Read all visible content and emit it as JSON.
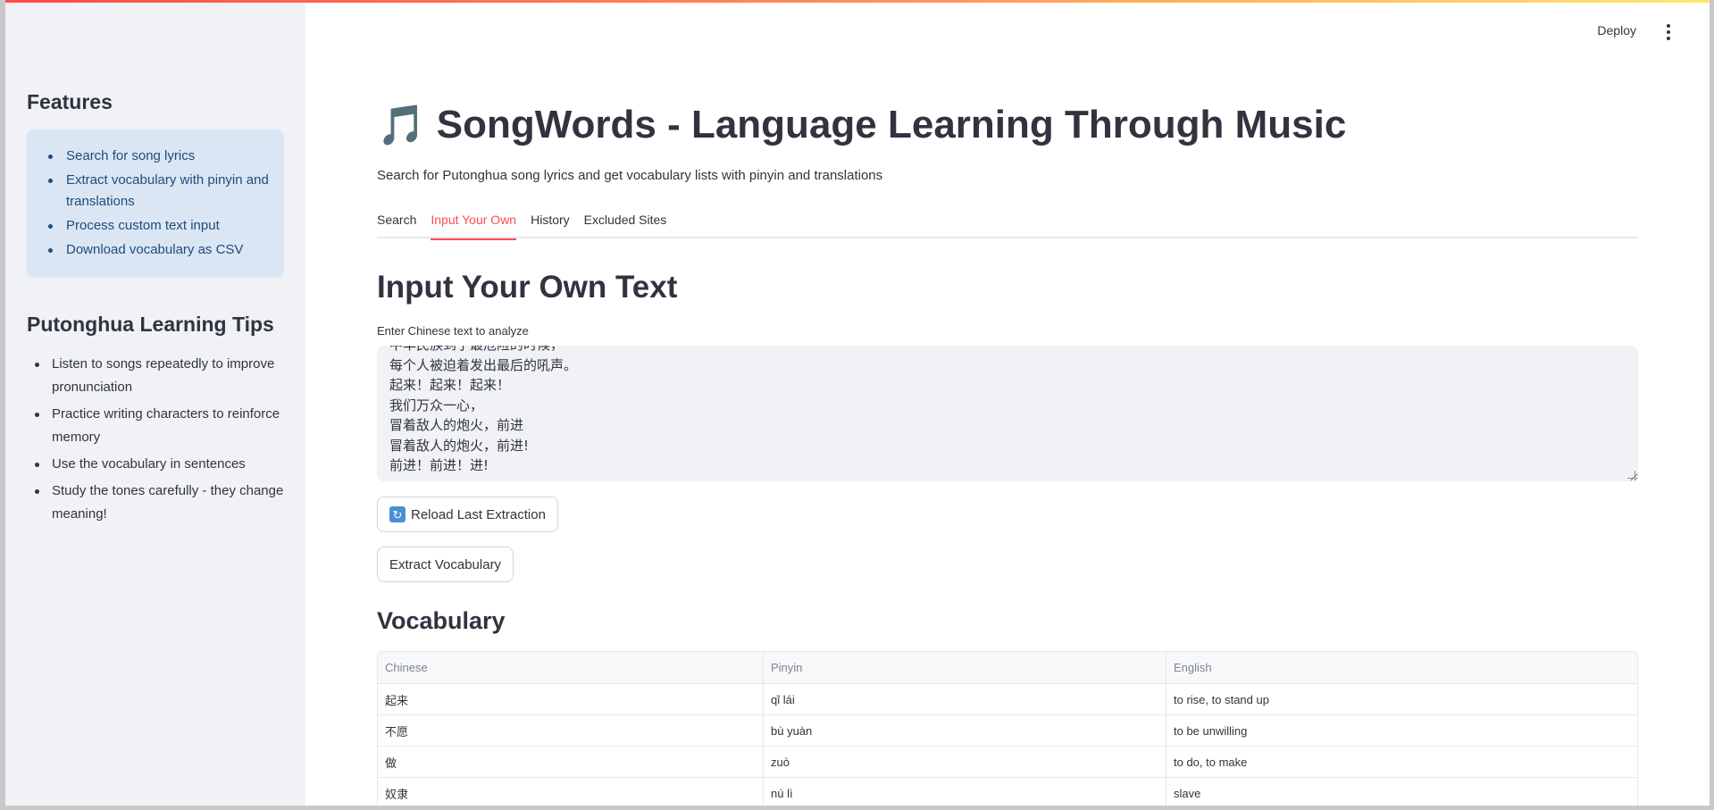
{
  "header": {
    "deploy_label": "Deploy"
  },
  "sidebar": {
    "features_title": "Features",
    "features": [
      "Search for song lyrics",
      "Extract vocabulary with pinyin and translations",
      "Process custom text input",
      "Download vocabulary as CSV"
    ],
    "tips_title": "Putonghua Learning Tips",
    "tips": [
      "Listen to songs repeatedly to improve pronunciation",
      "Practice writing characters to reinforce memory",
      "Use the vocabulary in sentences",
      "Study the tones carefully - they change meaning!"
    ]
  },
  "main": {
    "title_icon": "🎵",
    "title": "SongWords - Language Learning Through Music",
    "subtitle": "Search for Putonghua song lyrics and get vocabulary lists with pinyin and translations",
    "tabs": [
      {
        "label": "Search",
        "active": false
      },
      {
        "label": "Input Your Own",
        "active": true
      },
      {
        "label": "History",
        "active": false
      },
      {
        "label": "Excluded Sites",
        "active": false
      }
    ],
    "section_title": "Input Your Own Text",
    "textarea_label": "Enter Chinese text to analyze",
    "textarea_lines": [
      "中华民族到了最危险的时候，",
      "每个人被迫着发出最后的吼声。",
      "起来！起来！起来！",
      "我们万众一心，",
      "冒着敌人的炮火，前进",
      "冒着敌人的炮火，前进!",
      "前进！前进！进!"
    ],
    "reload_button": "Reload Last Extraction",
    "reload_icon": "refresh-icon",
    "extract_button": "Extract Vocabulary",
    "vocab_title": "Vocabulary",
    "table": {
      "headers": [
        "Chinese",
        "Pinyin",
        "English"
      ],
      "rows": [
        [
          "起来",
          "qǐ lái",
          "to rise, to stand up"
        ],
        [
          "不愿",
          "bù yuàn",
          "to be unwilling"
        ],
        [
          "做",
          "zuò",
          "to do, to make"
        ],
        [
          "奴隶",
          "nú lì",
          "slave"
        ]
      ]
    }
  },
  "colors": {
    "accent": "#ff4b4b",
    "sidebar_bg": "#f0f2f6",
    "features_box_bg": "#dbe6f4",
    "features_text": "#1f4c7a"
  }
}
